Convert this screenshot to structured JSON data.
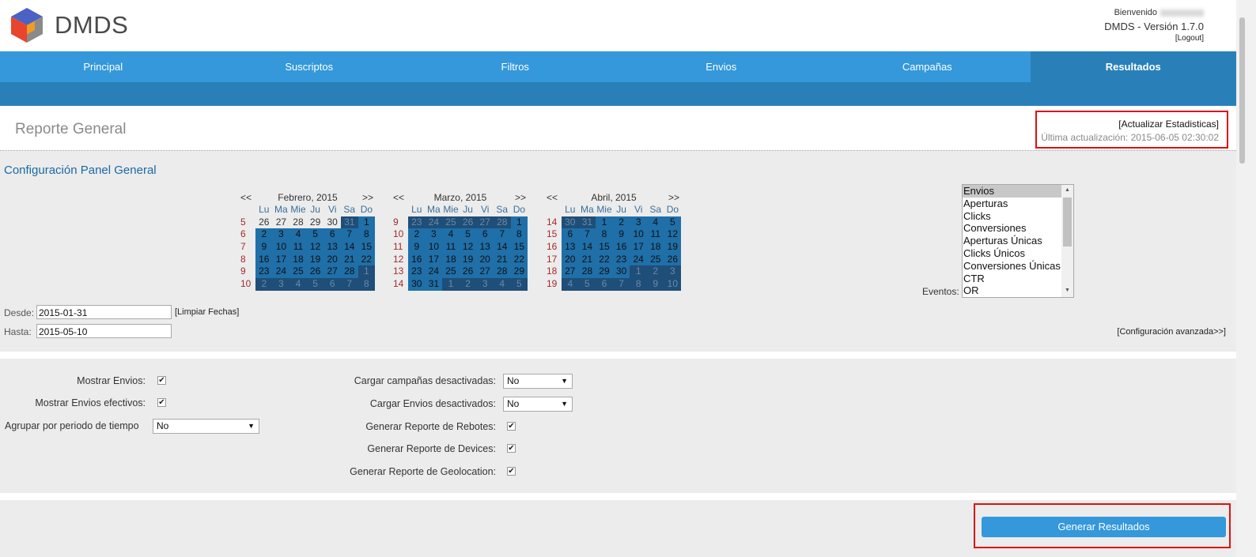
{
  "header": {
    "logo_text": "DMDS",
    "welcome": "Bienvenido",
    "version": "DMDS - Versión 1.7.0",
    "logout": "[Logout]"
  },
  "nav": {
    "items": [
      {
        "label": "Principal"
      },
      {
        "label": "Suscriptos"
      },
      {
        "label": "Filtros"
      },
      {
        "label": "Envios"
      },
      {
        "label": "Campañas"
      },
      {
        "label": "Resultados",
        "active": true
      }
    ]
  },
  "page": {
    "title": "Reporte General",
    "update_stats": "[Actualizar Estadisticas]",
    "last_update": "Última actualización: 2015-06-05 02:30:02"
  },
  "config": {
    "title": "Configuración Panel General"
  },
  "calendars": [
    {
      "prev": "<<",
      "next": ">>",
      "title": "Febrero, 2015",
      "day_names": [
        "Lu",
        "Ma",
        "Mie",
        "Ju",
        "Vi",
        "Sa",
        "Do"
      ],
      "weeks": [
        {
          "num": "5",
          "days": [
            "26",
            "27",
            "28",
            "29",
            "30",
            "31",
            "1"
          ],
          "state": [
            "p",
            "p",
            "p",
            "p",
            "p",
            "o",
            "s"
          ]
        },
        {
          "num": "6",
          "days": [
            "2",
            "3",
            "4",
            "5",
            "6",
            "7",
            "8"
          ],
          "state": [
            "s",
            "s",
            "s",
            "s",
            "s",
            "s",
            "s"
          ]
        },
        {
          "num": "7",
          "days": [
            "9",
            "10",
            "11",
            "12",
            "13",
            "14",
            "15"
          ],
          "state": [
            "s",
            "s",
            "s",
            "s",
            "s",
            "s",
            "s"
          ]
        },
        {
          "num": "8",
          "days": [
            "16",
            "17",
            "18",
            "19",
            "20",
            "21",
            "22"
          ],
          "state": [
            "s",
            "s",
            "s",
            "s",
            "s",
            "s",
            "s"
          ]
        },
        {
          "num": "9",
          "days": [
            "23",
            "24",
            "25",
            "26",
            "27",
            "28",
            "1"
          ],
          "state": [
            "s",
            "s",
            "s",
            "s",
            "s",
            "s",
            "o"
          ]
        },
        {
          "num": "10",
          "days": [
            "2",
            "3",
            "4",
            "5",
            "6",
            "7",
            "8"
          ],
          "state": [
            "o",
            "o",
            "o",
            "o",
            "o",
            "o",
            "o"
          ]
        }
      ]
    },
    {
      "prev": "<<",
      "next": ">>",
      "title": "Marzo, 2015",
      "day_names": [
        "Lu",
        "Ma",
        "Mie",
        "Ju",
        "Vi",
        "Sa",
        "Do"
      ],
      "weeks": [
        {
          "num": "9",
          "days": [
            "23",
            "24",
            "25",
            "26",
            "27",
            "28",
            "1"
          ],
          "state": [
            "o",
            "o",
            "o",
            "o",
            "o",
            "o",
            "s"
          ]
        },
        {
          "num": "10",
          "days": [
            "2",
            "3",
            "4",
            "5",
            "6",
            "7",
            "8"
          ],
          "state": [
            "s",
            "s",
            "s",
            "s",
            "s",
            "s",
            "s"
          ]
        },
        {
          "num": "11",
          "days": [
            "9",
            "10",
            "11",
            "12",
            "13",
            "14",
            "15"
          ],
          "state": [
            "s",
            "s",
            "s",
            "s",
            "s",
            "s",
            "s"
          ]
        },
        {
          "num": "12",
          "days": [
            "16",
            "17",
            "18",
            "19",
            "20",
            "21",
            "22"
          ],
          "state": [
            "s",
            "s",
            "s",
            "s",
            "s",
            "s",
            "s"
          ]
        },
        {
          "num": "13",
          "days": [
            "23",
            "24",
            "25",
            "26",
            "27",
            "28",
            "29"
          ],
          "state": [
            "s",
            "s",
            "s",
            "s",
            "s",
            "s",
            "s"
          ]
        },
        {
          "num": "14",
          "days": [
            "30",
            "31",
            "1",
            "2",
            "3",
            "4",
            "5"
          ],
          "state": [
            "s",
            "s",
            "o",
            "o",
            "o",
            "o",
            "o"
          ]
        }
      ]
    },
    {
      "prev": "<<",
      "next": ">>",
      "title": "Abril, 2015",
      "day_names": [
        "Lu",
        "Ma",
        "Mie",
        "Ju",
        "Vi",
        "Sa",
        "Do"
      ],
      "weeks": [
        {
          "num": "14",
          "days": [
            "30",
            "31",
            "1",
            "2",
            "3",
            "4",
            "5"
          ],
          "state": [
            "o",
            "o",
            "s",
            "s",
            "s",
            "s",
            "s"
          ]
        },
        {
          "num": "15",
          "days": [
            "6",
            "7",
            "8",
            "9",
            "10",
            "11",
            "12"
          ],
          "state": [
            "s",
            "s",
            "s",
            "s",
            "s",
            "s",
            "s"
          ]
        },
        {
          "num": "16",
          "days": [
            "13",
            "14",
            "15",
            "16",
            "17",
            "18",
            "19"
          ],
          "state": [
            "s",
            "s",
            "s",
            "s",
            "s",
            "s",
            "s"
          ]
        },
        {
          "num": "17",
          "days": [
            "20",
            "21",
            "22",
            "23",
            "24",
            "25",
            "26"
          ],
          "state": [
            "s",
            "s",
            "s",
            "s",
            "s",
            "s",
            "s"
          ]
        },
        {
          "num": "18",
          "days": [
            "27",
            "28",
            "29",
            "30",
            "1",
            "2",
            "3"
          ],
          "state": [
            "s",
            "s",
            "s",
            "s",
            "o",
            "o",
            "o"
          ]
        },
        {
          "num": "19",
          "days": [
            "4",
            "5",
            "6",
            "7",
            "8",
            "9",
            "10"
          ],
          "state": [
            "o",
            "o",
            "o",
            "o",
            "o",
            "o",
            "o"
          ]
        }
      ]
    }
  ],
  "events": {
    "label": "Eventos:",
    "options": [
      "Envios",
      "Aperturas",
      "Clicks",
      "Conversiones",
      "Aperturas Únicas",
      "Clicks Únicos",
      "Conversiones Únicas",
      "CTR",
      "OR"
    ],
    "selected": "Envios"
  },
  "dates": {
    "from_label": "Desde:",
    "from_value": "2015-01-31",
    "to_label": "Hasta:",
    "to_value": "2015-05-10",
    "clear": "[Limpiar Fechas]",
    "advanced": "[Configuración avanzada>>]"
  },
  "options": {
    "show_sends": "Mostrar Envios:",
    "show_effective": "Mostrar Envios efectivos:",
    "group_by": "Agrupar por periodo de tiempo",
    "group_by_value": "No",
    "load_campaigns": "Cargar campañas desactivadas:",
    "load_campaigns_value": "No",
    "load_sends": "Cargar Envios desactivados:",
    "load_sends_value": "No",
    "bounces": "Generar Reporte de Rebotes:",
    "devices": "Generar Reporte de Devices:",
    "geolocation": "Generar Reporte de Geolocation:",
    "checkmark": "✔",
    "caret": "▼"
  },
  "actions": {
    "generate": "Generar Resultados"
  }
}
